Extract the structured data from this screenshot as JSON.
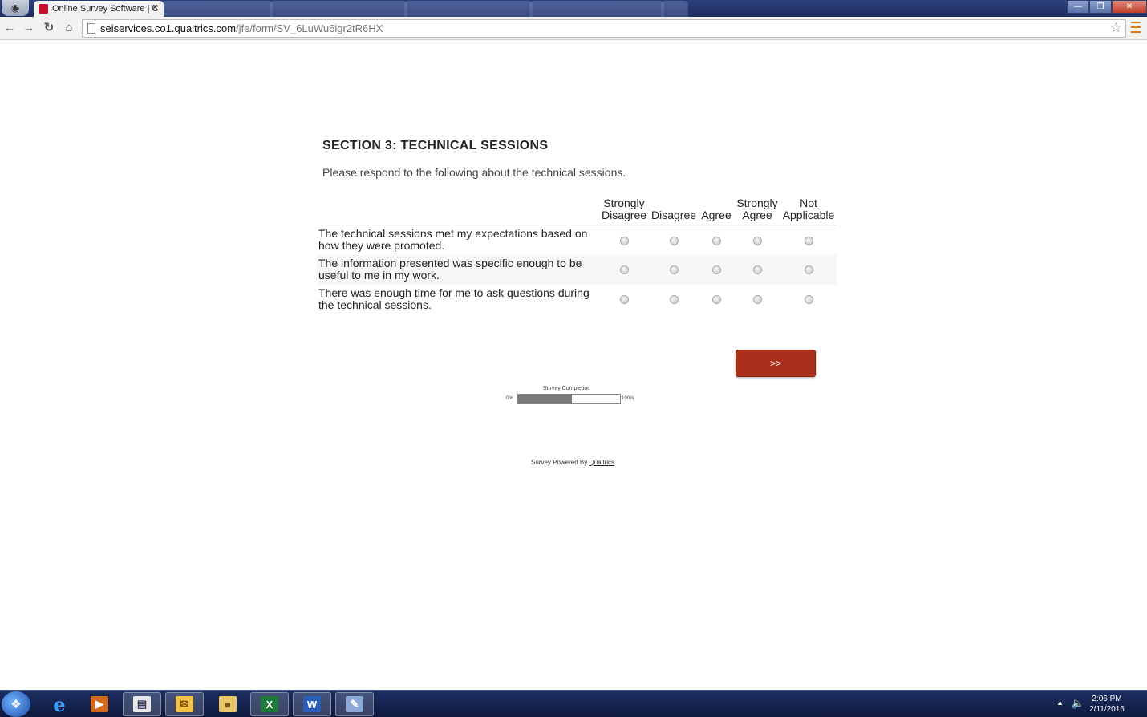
{
  "browser": {
    "active_tab_title": "Online Survey Software | C",
    "url_host": "seiservices.co1.qualtrics.com",
    "url_path": "/jfe/form/SV_6LuWu6igr2tR6HX"
  },
  "survey": {
    "section_title": "SECTION 3:  TECHNICAL SESSIONS",
    "intro": "Please respond to the following about the technical sessions.",
    "columns": [
      {
        "line1": "Strongly",
        "line2": "Disagree"
      },
      {
        "line1": "",
        "line2": "Disagree"
      },
      {
        "line1": "",
        "line2": "Agree"
      },
      {
        "line1": "Strongly",
        "line2": "Agree"
      },
      {
        "line1": "Not",
        "line2": "Applicable"
      }
    ],
    "statements": [
      "The technical sessions met my expectations based on how they were promoted.",
      "The information presented was specific enough to be useful to me in my work.",
      "There was enough time for me to ask questions during the technical sessions."
    ],
    "next_button": ">>",
    "progress": {
      "label": "Survey Completion",
      "min_label": "0%",
      "max_label": "100%",
      "value_fraction": 0.53
    },
    "footer_text": "Survey Powered By ",
    "footer_link": "Qualtrics"
  },
  "taskbar": {
    "time": "2:06 PM",
    "date": "2/11/2016"
  },
  "colors": {
    "next_button": "#a8301a",
    "progress_fill": "#7a7a7a",
    "taskbar": "#1c2e63"
  }
}
